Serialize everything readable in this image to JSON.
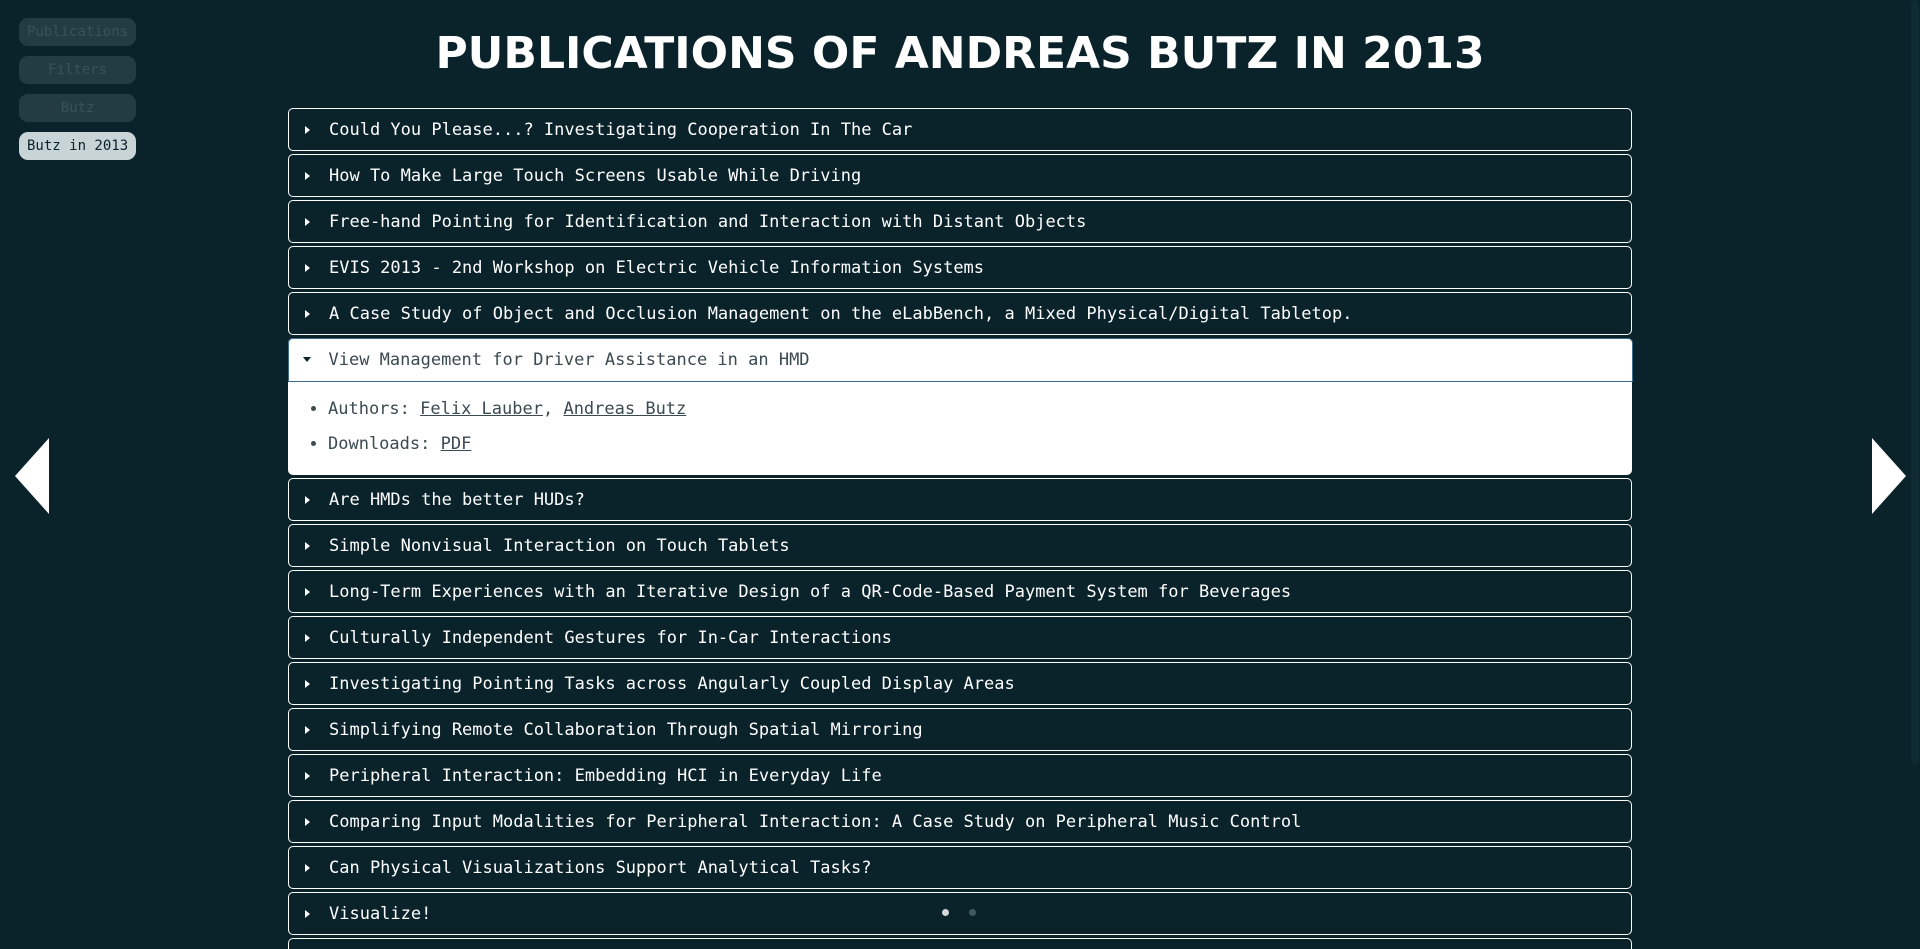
{
  "nav": {
    "items": [
      {
        "label": "Publications",
        "active": false
      },
      {
        "label": "Filters",
        "active": false
      },
      {
        "label": "Butz",
        "active": false
      },
      {
        "label": "Butz in 2013",
        "active": true
      }
    ]
  },
  "page": {
    "title": "Publications of Andreas Butz in 2013"
  },
  "publications": [
    {
      "title": "Could You Please...? Investigating Cooperation In The Car"
    },
    {
      "title": "How To Make Large Touch Screens Usable While Driving"
    },
    {
      "title": "Free-hand Pointing for Identification and Interaction with Distant Objects"
    },
    {
      "title": "EVIS 2013 - 2nd Workshop on Electric Vehicle Information Systems"
    },
    {
      "title": "A Case Study of Object and Occlusion Management on the eLabBench, a Mixed Physical/Digital Tabletop."
    },
    {
      "title": "View Management for Driver Assistance in an HMD"
    },
    {
      "title": "Are HMDs the better HUDs?"
    },
    {
      "title": "Simple Nonvisual Interaction on Touch Tablets"
    },
    {
      "title": "Long-Term Experiences with an Iterative Design of a QR-Code-Based Payment System for Beverages"
    },
    {
      "title": "Culturally Independent Gestures for In-Car Interactions"
    },
    {
      "title": "Investigating Pointing Tasks across Angularly Coupled Display Areas"
    },
    {
      "title": "Simplifying Remote Collaboration Through Spatial Mirroring"
    },
    {
      "title": "Peripheral Interaction: Embedding HCI in Everyday Life"
    },
    {
      "title": "Comparing Input Modalities for Peripheral Interaction: A Case Study on Peripheral Music Control"
    },
    {
      "title": "Can Physical Visualizations Support Analytical Tasks?"
    },
    {
      "title": "Visualize!"
    }
  ],
  "expanded": {
    "authors_label": "Authors:",
    "authors": [
      "Felix Lauber",
      "Andreas Butz"
    ],
    "separator": ", ",
    "downloads_label": "Downloads:",
    "download_link": "PDF"
  },
  "icons": {
    "prev": "left-arrow-icon",
    "next": "right-arrow-icon",
    "caret": "caret-icon"
  },
  "colors": {
    "background": "#0a222a",
    "text": "#ffffff",
    "open_item_bg": "#ffffff",
    "open_item_border": "#3e6b8a"
  }
}
